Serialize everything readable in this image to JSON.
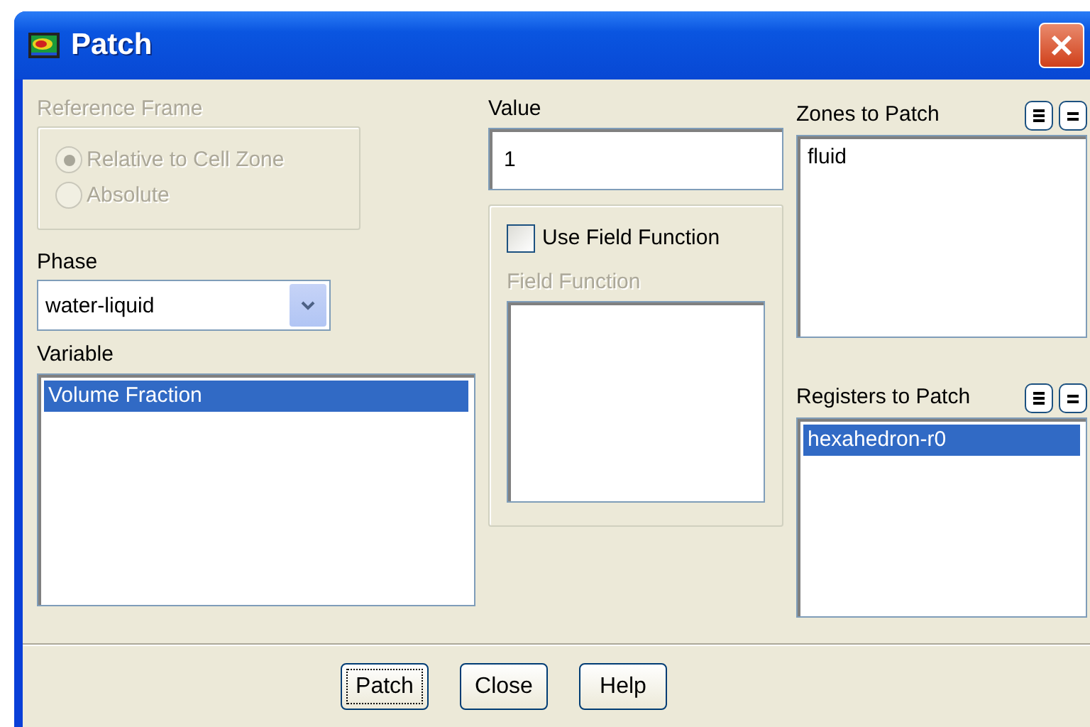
{
  "window": {
    "title": "Patch"
  },
  "reference_frame": {
    "label": "Reference Frame",
    "disabled": true,
    "options": [
      {
        "label": "Relative to Cell Zone",
        "selected": true
      },
      {
        "label": "Absolute",
        "selected": false
      }
    ]
  },
  "phase": {
    "label": "Phase",
    "value": "water-liquid"
  },
  "variable": {
    "label": "Variable",
    "items": [
      {
        "label": "Volume Fraction",
        "selected": true
      }
    ]
  },
  "value": {
    "label": "Value",
    "value": "1"
  },
  "use_field_function": {
    "label": "Use Field Function",
    "checked": false
  },
  "field_function": {
    "label": "Field Function",
    "disabled": true
  },
  "zones": {
    "label": "Zones to Patch",
    "items": [
      {
        "label": "fluid",
        "selected": false
      }
    ]
  },
  "registers": {
    "label": "Registers to Patch",
    "items": [
      {
        "label": "hexahedron-r0",
        "selected": true
      }
    ]
  },
  "buttons": [
    {
      "label": "Patch",
      "focused": true
    },
    {
      "label": "Close",
      "focused": false
    },
    {
      "label": "Help",
      "focused": false
    }
  ]
}
